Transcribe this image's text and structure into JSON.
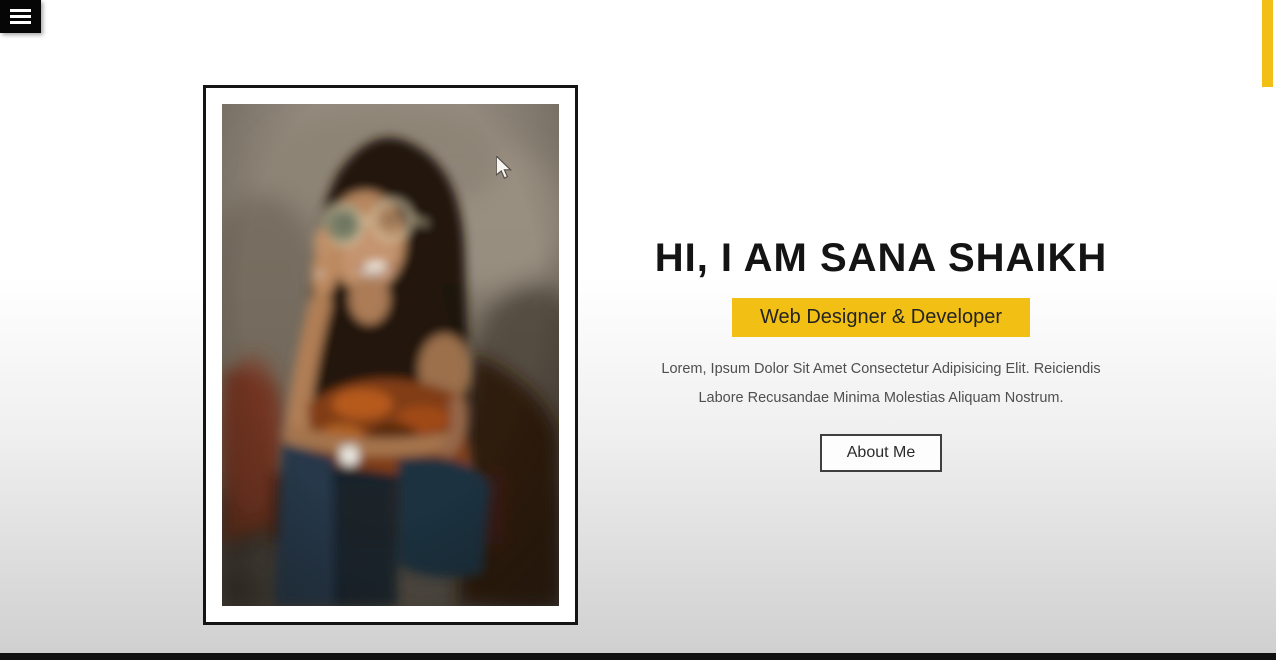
{
  "page": {
    "background_top": "#ffffff",
    "background_bottom": "#cfcfcf",
    "bottom_bar_color": "#111111"
  },
  "nav": {
    "menu_icon": "hamburger-icon",
    "menu_background": "#060606"
  },
  "hero": {
    "heading": "HI, I AM SANA SHAIKH",
    "role_badge": "Web Designer & Developer",
    "description_line1": "Lorem, Ipsum Dolor Sit Amet Consectetur Adipisicing Elit. Reiciendis",
    "description_line2": "Labore Recusandae Minima Molestias Aliquam Nostrum.",
    "about_button_label": "About Me"
  },
  "photo": {
    "description": "Smiling woman with glasses and long dark hair, hand raised to her face, wearing an orange top and jeans, seated on a brown leather chair against a concrete wall",
    "frame_border_color": "#141414"
  },
  "colors": {
    "accent_yellow": "#F2C014",
    "heading_text": "#141414",
    "body_text": "#4f4f4f",
    "button_border": "#3f3f3f"
  },
  "scrollbar": {
    "thumb_color": "#F2C014"
  },
  "cursor_icon": "arrow-cursor"
}
